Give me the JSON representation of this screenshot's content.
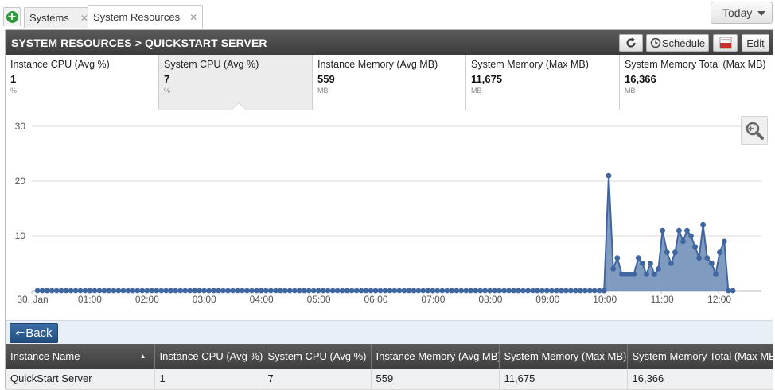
{
  "tabs": {
    "add_label": "+",
    "items": [
      {
        "label": "Systems",
        "close": "✕"
      },
      {
        "label": "System Resources",
        "close": "✕"
      }
    ]
  },
  "today": {
    "label": "Today"
  },
  "panel": {
    "title": "SYSTEM RESOURCES > QUICKSTART SERVER",
    "buttons": {
      "refresh_icon": "refresh-icon",
      "schedule": "Schedule",
      "pdf_icon": "pdf-icon",
      "edit": "Edit"
    }
  },
  "metrics": [
    {
      "label": "Instance CPU (Avg %)",
      "value": "1",
      "unit": "%"
    },
    {
      "label": "System CPU (Avg %)",
      "value": "7",
      "unit": "%"
    },
    {
      "label": "Instance Memory (Avg MB)",
      "value": "559",
      "unit": "MB"
    },
    {
      "label": "System Memory (Max MB)",
      "value": "11,675",
      "unit": "MB"
    },
    {
      "label": "System Memory Total (Max MB)",
      "value": "16,366",
      "unit": "MB"
    }
  ],
  "selected_metric": 1,
  "chart_data": {
    "type": "area",
    "x_labels": [
      "30. Jan",
      "01:00",
      "02:00",
      "03:00",
      "04:00",
      "05:00",
      "06:00",
      "07:00",
      "08:00",
      "09:00",
      "10:00",
      "11:00",
      "12:00"
    ],
    "x_range_hours": [
      0,
      12.75
    ],
    "y_ticks": [
      10,
      20,
      30
    ],
    "ylim": [
      0,
      30
    ],
    "grid": true,
    "color": "#6a8ab5",
    "line_color": "#3f66a0",
    "flat_until_hour": 10.0,
    "flat_point_count": 120,
    "tail": [
      [
        10.0,
        0
      ],
      [
        10.08,
        21
      ],
      [
        10.16,
        4
      ],
      [
        10.23,
        6
      ],
      [
        10.31,
        3
      ],
      [
        10.38,
        3
      ],
      [
        10.45,
        3
      ],
      [
        10.52,
        3
      ],
      [
        10.6,
        6
      ],
      [
        10.67,
        5
      ],
      [
        10.74,
        3
      ],
      [
        10.81,
        5
      ],
      [
        10.88,
        3
      ],
      [
        10.95,
        4
      ],
      [
        11.02,
        11
      ],
      [
        11.1,
        7
      ],
      [
        11.17,
        5
      ],
      [
        11.24,
        7
      ],
      [
        11.31,
        11
      ],
      [
        11.38,
        9
      ],
      [
        11.45,
        11
      ],
      [
        11.52,
        10
      ],
      [
        11.59,
        8
      ],
      [
        11.66,
        6
      ],
      [
        11.73,
        12
      ],
      [
        11.8,
        6
      ],
      [
        11.88,
        5
      ],
      [
        11.95,
        3
      ],
      [
        12.02,
        7
      ],
      [
        12.1,
        9
      ],
      [
        12.17,
        0
      ],
      [
        12.25,
        0
      ]
    ]
  },
  "zoom_icon": "zoom-out-icon",
  "back": {
    "label": "Back",
    "arrow": "⇐"
  },
  "table": {
    "sort_indicator": "▲",
    "columns": [
      "Instance Name",
      "Instance CPU (Avg %)",
      "System CPU (Avg %)",
      "Instance Memory (Avg MB)",
      "System Memory (Max MB)",
      "System Memory Total (Max MB"
    ],
    "rows": [
      [
        "QuickStart Server",
        "1",
        "7",
        "559",
        "11,675",
        "16,366"
      ]
    ]
  }
}
